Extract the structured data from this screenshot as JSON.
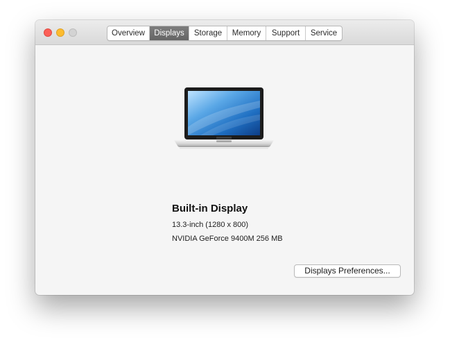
{
  "window": {
    "tabs": [
      {
        "label": "Overview",
        "active": false
      },
      {
        "label": "Displays",
        "active": true
      },
      {
        "label": "Storage",
        "active": false
      },
      {
        "label": "Memory",
        "active": false
      },
      {
        "label": "Support",
        "active": false
      },
      {
        "label": "Service",
        "active": false
      }
    ]
  },
  "display": {
    "icon": "macbook-laptop-icon",
    "title": "Built-in Display",
    "resolution": "13.3-inch (1280 x 800)",
    "gpu": "NVIDIA GeForce 9400M 256 MB"
  },
  "actions": {
    "preferences_label": "Displays Preferences..."
  },
  "colors": {
    "close": "#fc5f57",
    "minimize": "#fdbc2f",
    "zoom_inactive": "#d3d3d3",
    "active_tab": "#6e6e6e",
    "window_background": "#f5f5f5"
  }
}
